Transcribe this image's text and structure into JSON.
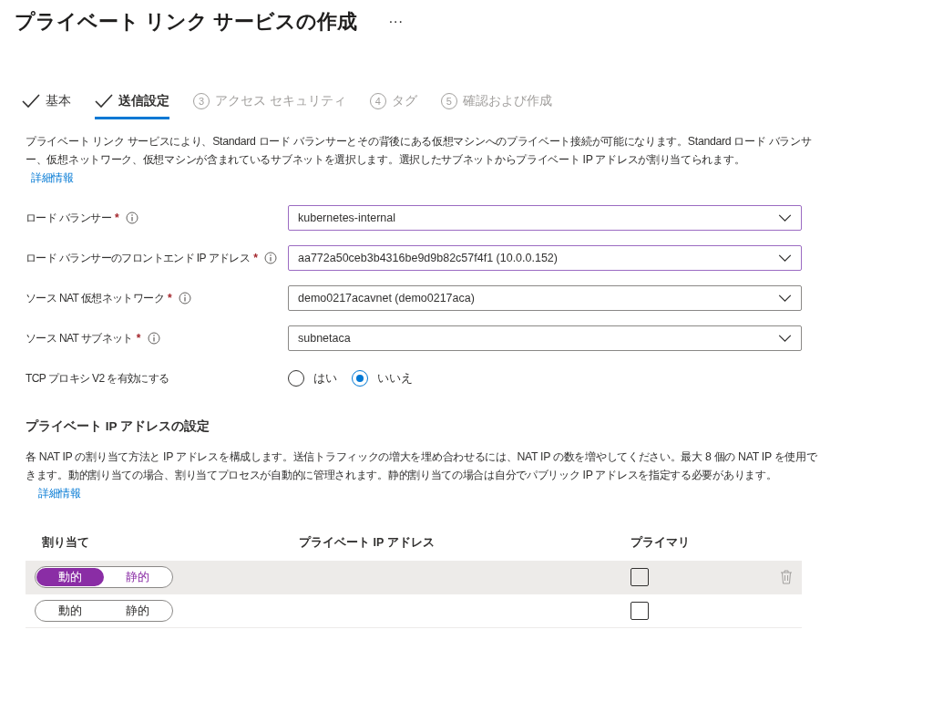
{
  "page_title": "プライベート リンク サービスの作成",
  "more": "···",
  "steps": [
    {
      "kind": "done",
      "label": "基本",
      "selected": false
    },
    {
      "kind": "done",
      "label": "送信設定",
      "selected": true
    },
    {
      "kind": "pending",
      "number": "3",
      "label": "アクセス セキュリティ",
      "selected": false
    },
    {
      "kind": "pending",
      "number": "4",
      "label": "タグ",
      "selected": false
    },
    {
      "kind": "pending",
      "number": "5",
      "label": "確認および作成",
      "selected": false
    }
  ],
  "description": "プライベート リンク サービスにより、Standard ロード バランサーとその背後にある仮想マシンへのプライベート接続が可能になります。Standard ロード バランサー、仮想ネットワーク、仮想マシンが含まれているサブネットを選択します。選択したサブネットからプライベート IP アドレスが割り当てられます。",
  "description_link": "詳細情報",
  "fields": [
    {
      "kind": "dropdown",
      "label": "ロード バランサー",
      "required_mark": "*",
      "value": "kubernetes-internal",
      "focused": true
    },
    {
      "kind": "dropdown",
      "label": "ロード バランサーのフロントエンド IP アドレス",
      "required_mark": "*",
      "value": "aa772a50ceb3b4316be9d9b82c57f4f1 (10.0.0.152)",
      "focused": true
    },
    {
      "kind": "dropdown",
      "label": "ソース NAT 仮想ネットワーク",
      "required_mark": "*",
      "value": "demo0217acavnet (demo0217aca)",
      "focused": false
    },
    {
      "kind": "dropdown",
      "label": "ソース NAT サブネット",
      "required_mark": "*",
      "value": "subnetaca",
      "focused": false
    },
    {
      "kind": "radio",
      "label": "TCP プロキシ V2 を有効にする",
      "options": [
        {
          "label": "はい",
          "selected": false
        },
        {
          "label": "いいえ",
          "selected": true
        }
      ]
    }
  ],
  "ip_section": {
    "heading": "プライベート IP アドレスの設定",
    "text": "各 NAT IP の割り当て方法と IP アドレスを構成します。送信トラフィックの増大を埋め合わせるには、NAT IP の数を増やしてください。最大 8 個の NAT IP を使用できます。動的割り当ての場合、割り当てプロセスが自動的に管理されます。静的割り当ての場合は自分でパブリック IP アドレスを指定する必要があります。",
    "link": "詳細情報",
    "columns": [
      "割り当て",
      "プライベート IP アドレス",
      "プライマリ"
    ],
    "rows": [
      {
        "highlighted": true,
        "allocation": [
          {
            "label": "動的",
            "selected": true
          },
          {
            "label": "静的",
            "selected": false
          }
        ],
        "primary": false
      },
      {
        "highlighted": false,
        "allocation": [
          {
            "label": "動的",
            "selected": false
          },
          {
            "label": "静的",
            "selected": false
          }
        ],
        "primary": false
      }
    ]
  }
}
